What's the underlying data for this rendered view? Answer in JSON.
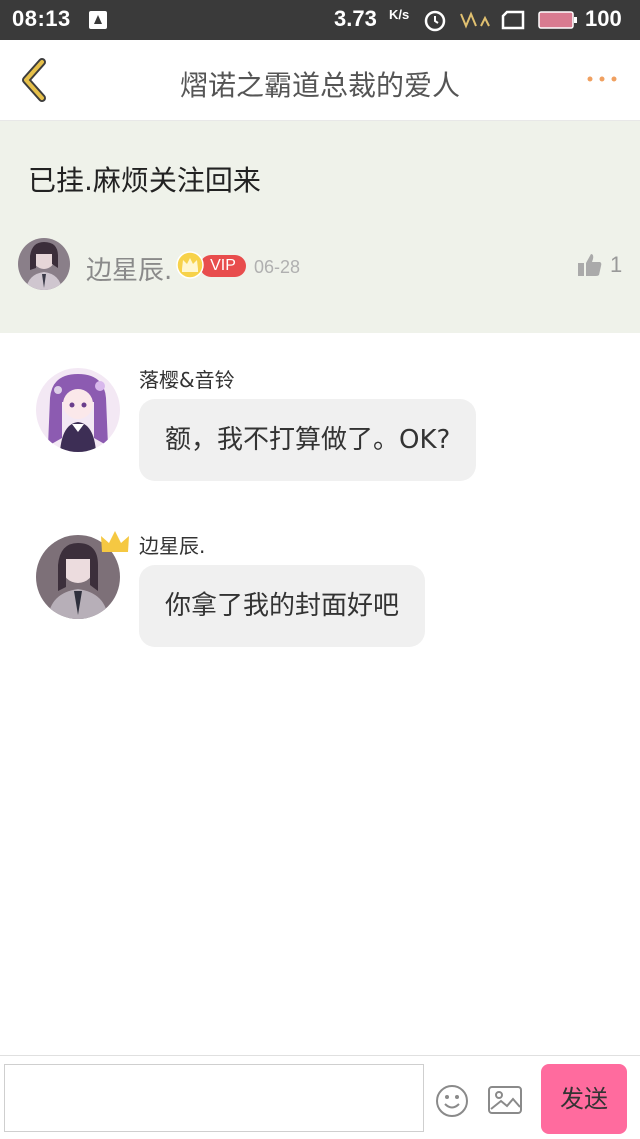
{
  "status_bar": {
    "time": "08:13",
    "speed": "3.73",
    "speed_unit": "K/s",
    "battery_level": "100",
    "icons": [
      "notification-icon",
      "alarm-icon",
      "signal-icon",
      "sim-icon",
      "battery-icon"
    ]
  },
  "header": {
    "title": "熠诺之霸道总裁的爱人",
    "back_icon": "chevron-left-icon",
    "more_icon": "more-dots-icon",
    "accent_color": "#d9a645"
  },
  "post": {
    "text": "已挂.麻烦关注回来",
    "author": "边星辰.",
    "badge": "VIP",
    "date": "06-28",
    "like_count": "1",
    "background": "#eff2ea"
  },
  "messages": [
    {
      "name": "落樱&音铃",
      "text": "额，我不打算做了。OK?"
    },
    {
      "name": "边星辰.",
      "text": "你拿了我的封面好吧"
    }
  ],
  "input_bar": {
    "placeholder": "",
    "send_label": "发送",
    "emoji_icon": "smiley-icon",
    "image_icon": "image-icon",
    "send_color": "#ff6b9e"
  }
}
